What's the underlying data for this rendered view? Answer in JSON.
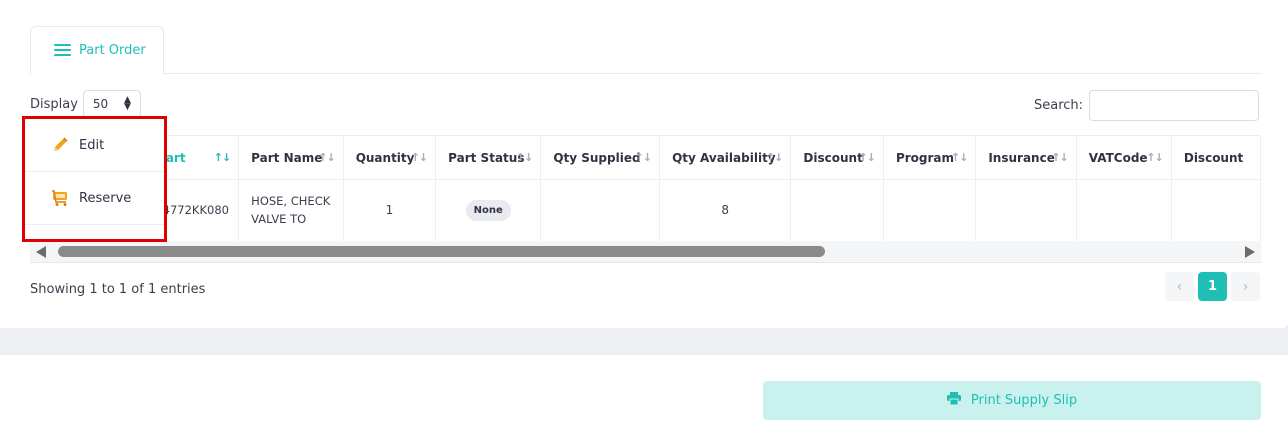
{
  "tab": {
    "label": "Part Order",
    "icon": "list-icon"
  },
  "controls": {
    "display_label": "Display",
    "display_value": "50",
    "search_label": "Search:",
    "search_value": ""
  },
  "table": {
    "columns": [
      "Part",
      "Part Name",
      "Quantity",
      "Part Status",
      "Qty Supplied",
      "Qty Availability",
      "Discount",
      "Program",
      "Insurance",
      "VATCode",
      "Discount"
    ],
    "row": {
      "part": "44772KK080",
      "part_name": "HOSE, CHECK VALVE TO",
      "quantity": "1",
      "part_status": "None",
      "qty_supplied": "",
      "qty_availability": "8",
      "discount": "",
      "program": "",
      "insurance": "",
      "vatcode": "",
      "discount2": ""
    }
  },
  "context_menu": {
    "items": [
      {
        "label": "Edit",
        "icon": "pencil-icon"
      },
      {
        "label": "Reserve",
        "icon": "cart-icon"
      }
    ]
  },
  "footer": {
    "showing": "Showing 1 to 1 of 1 entries",
    "current_page": "1",
    "prev": "‹",
    "next": "›"
  },
  "print_button": {
    "label": "Print Supply Slip",
    "icon": "printer-icon"
  },
  "colors": {
    "accent": "#1fbfb6",
    "highlight": "#e00000"
  }
}
